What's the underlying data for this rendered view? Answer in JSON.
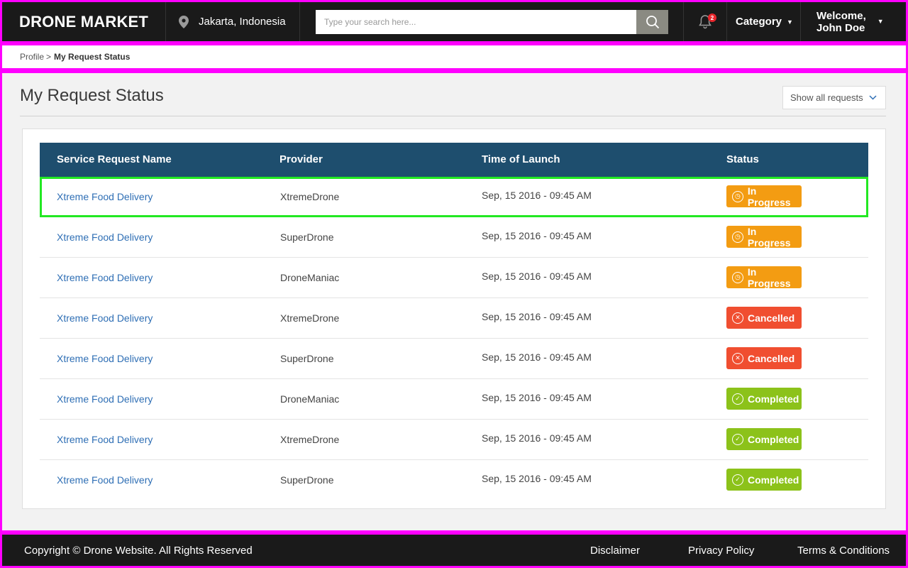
{
  "header": {
    "brand": "DRONE MARKET",
    "location": "Jakarta, Indonesia",
    "search_placeholder": "Type your search here...",
    "notification_count": "2",
    "category_label": "Category",
    "welcome_line1": "Welcome,",
    "welcome_line2": "John Doe"
  },
  "breadcrumb": {
    "parent": "Profile",
    "separator": ">",
    "current": "My Request Status"
  },
  "main": {
    "title": "My Request Status",
    "filter_label": "Show all requests"
  },
  "table": {
    "columns": [
      "Service Request Name",
      "Provider",
      "Time of Launch",
      "Status"
    ],
    "rows": [
      {
        "name": "Xtreme Food Delivery",
        "provider": "XtremeDrone",
        "time": "Sep, 15 2016 - 09:45 AM",
        "status": "In Progress",
        "status_kind": "progress"
      },
      {
        "name": "Xtreme Food Delivery",
        "provider": "SuperDrone",
        "time": "Sep, 15 2016 - 09:45 AM",
        "status": "In Progress",
        "status_kind": "progress"
      },
      {
        "name": "Xtreme Food Delivery",
        "provider": "DroneManiac",
        "time": "Sep, 15 2016 - 09:45 AM",
        "status": "In Progress",
        "status_kind": "progress"
      },
      {
        "name": "Xtreme Food Delivery",
        "provider": "XtremeDrone",
        "time": "Sep, 15 2016 - 09:45 AM",
        "status": "Cancelled",
        "status_kind": "cancelled"
      },
      {
        "name": "Xtreme Food Delivery",
        "provider": "SuperDrone",
        "time": "Sep, 15 2016 - 09:45 AM",
        "status": "Cancelled",
        "status_kind": "cancelled"
      },
      {
        "name": "Xtreme Food Delivery",
        "provider": "DroneManiac",
        "time": "Sep, 15 2016 - 09:45 AM",
        "status": "Completed",
        "status_kind": "completed"
      },
      {
        "name": "Xtreme Food Delivery",
        "provider": "XtremeDrone",
        "time": "Sep, 15 2016 - 09:45 AM",
        "status": "Completed",
        "status_kind": "completed"
      },
      {
        "name": "Xtreme Food Delivery",
        "provider": "SuperDrone",
        "time": "Sep, 15 2016 - 09:45 AM",
        "status": "Completed",
        "status_kind": "completed"
      }
    ]
  },
  "status_colors": {
    "progress": "#f39c12",
    "cancelled": "#f04e30",
    "completed": "#8cc21a"
  },
  "status_icons": {
    "progress": "timer-icon",
    "cancelled": "x-circle-icon",
    "completed": "check-circle-icon"
  },
  "footer": {
    "copyright": "Copyright © Drone Website. All Rights Reserved",
    "disclaimer": "Disclaimer",
    "privacy": "Privacy Policy",
    "terms": "Terms & Conditions"
  },
  "theme": {
    "header_bg": "#1a1a1a",
    "table_header_bg": "#1e4e6e",
    "link_color": "#2f6fb5",
    "frame_color": "#ff00ff",
    "highlight_color": "#22e822"
  }
}
